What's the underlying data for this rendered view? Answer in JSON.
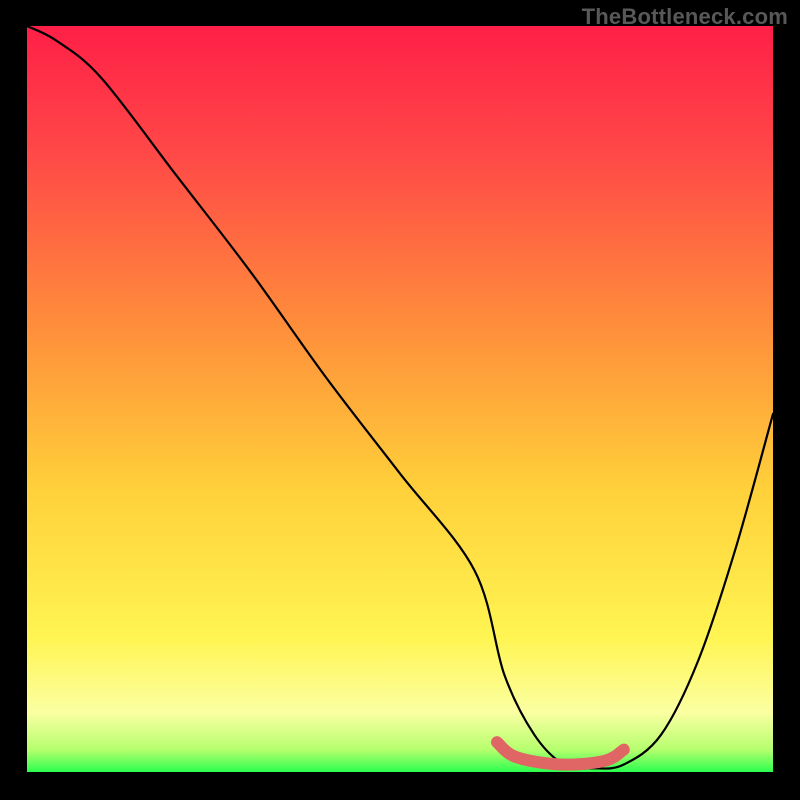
{
  "watermark": "TheBottleneck.com",
  "chart_data": {
    "type": "line",
    "title": "",
    "xlabel": "",
    "ylabel": "",
    "xlim": [
      0,
      100
    ],
    "ylim": [
      0,
      100
    ],
    "grid": false,
    "series": [
      {
        "name": "bottleneck-curve",
        "x": [
          0,
          4,
          10,
          20,
          30,
          40,
          50,
          60,
          64,
          68,
          72,
          76,
          80,
          85,
          90,
          95,
          100
        ],
        "y": [
          100,
          98,
          93,
          80,
          67,
          53,
          40,
          27,
          13,
          5,
          1,
          0.5,
          1,
          5,
          15,
          30,
          48
        ]
      }
    ],
    "highlight": {
      "name": "optimal-range",
      "x": [
        63,
        80
      ],
      "y_level": 1
    },
    "gradient": {
      "type": "vertical",
      "stops": [
        {
          "offset": 0,
          "color": "#ff1f47"
        },
        {
          "offset": 0.18,
          "color": "#ff4b47"
        },
        {
          "offset": 0.4,
          "color": "#ff8d3b"
        },
        {
          "offset": 0.62,
          "color": "#ffd03a"
        },
        {
          "offset": 0.82,
          "color": "#fff552"
        },
        {
          "offset": 0.92,
          "color": "#fbffa2"
        },
        {
          "offset": 0.97,
          "color": "#b6ff6e"
        },
        {
          "offset": 1.0,
          "color": "#2bff4e"
        }
      ]
    }
  }
}
